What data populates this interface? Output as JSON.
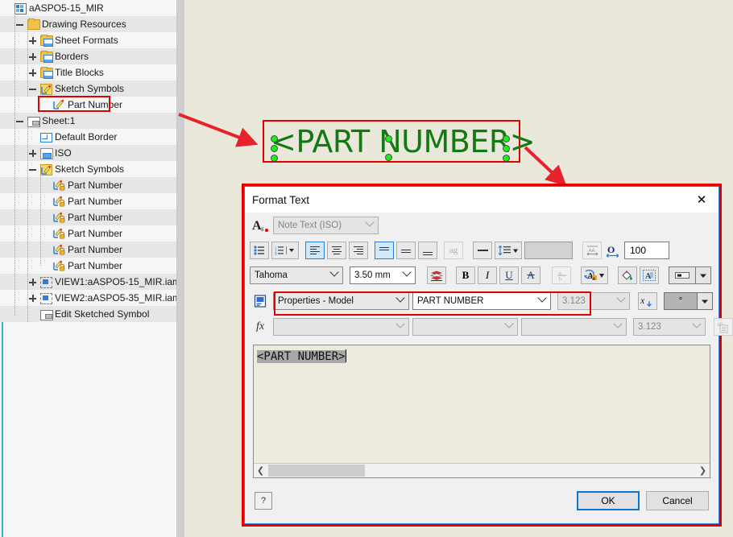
{
  "app": {
    "document_title": "aASPO5-15_MIR"
  },
  "tree": {
    "items": [
      {
        "label": "aASPO5-15_MIR",
        "icon": "assembly-icon",
        "depth": 0,
        "expander": "none",
        "alt": false
      },
      {
        "label": "Drawing Resources",
        "icon": "folder-icon",
        "depth": 1,
        "expander": "minus",
        "alt": true
      },
      {
        "label": "Sheet Formats",
        "icon": "folder-blue-icon",
        "depth": 2,
        "expander": "plus",
        "alt": false
      },
      {
        "label": "Borders",
        "icon": "folder-blue-icon",
        "depth": 2,
        "expander": "plus",
        "alt": true
      },
      {
        "label": "Title Blocks",
        "icon": "folder-blue-icon",
        "depth": 2,
        "expander": "plus",
        "alt": false
      },
      {
        "label": "Sketch Symbols",
        "icon": "sketch-symbol-icon",
        "depth": 2,
        "expander": "minus",
        "alt": true
      },
      {
        "label": "Part Number",
        "icon": "sketch-symbol-item-icon",
        "depth": 3,
        "expander": "none",
        "alt": false
      },
      {
        "label": "Sheet:1",
        "icon": "sheet-icon",
        "depth": 1,
        "expander": "minus",
        "alt": true
      },
      {
        "label": "Default Border",
        "icon": "border-icon",
        "depth": 2,
        "expander": "none",
        "alt": false
      },
      {
        "label": "ISO",
        "icon": "title-block-icon",
        "depth": 2,
        "expander": "plus",
        "alt": true
      },
      {
        "label": "Sketch Symbols",
        "icon": "sketch-symbol-icon",
        "depth": 2,
        "expander": "minus",
        "alt": false
      },
      {
        "label": "Part Number",
        "icon": "sketch-symbol-locked-icon",
        "depth": 3,
        "expander": "none",
        "alt": true
      },
      {
        "label": "Part Number",
        "icon": "sketch-symbol-locked-icon",
        "depth": 3,
        "expander": "none",
        "alt": false
      },
      {
        "label": "Part Number",
        "icon": "sketch-symbol-locked-icon",
        "depth": 3,
        "expander": "none",
        "alt": true
      },
      {
        "label": "Part Number",
        "icon": "sketch-symbol-locked-icon",
        "depth": 3,
        "expander": "none",
        "alt": false
      },
      {
        "label": "Part Number",
        "icon": "sketch-symbol-locked-icon",
        "depth": 3,
        "expander": "none",
        "alt": true
      },
      {
        "label": "Part Number",
        "icon": "sketch-symbol-locked-icon",
        "depth": 3,
        "expander": "none",
        "alt": false
      },
      {
        "label": "VIEW1:aASPO5-15_MIR.iam",
        "icon": "view-icon",
        "depth": 2,
        "expander": "plus",
        "alt": true
      },
      {
        "label": "VIEW2:aASPO5-35_MIR.iam",
        "icon": "view-icon",
        "depth": 2,
        "expander": "plus",
        "alt": false
      },
      {
        "label": "Edit Sketched Symbol",
        "icon": "edit-sketched-symbol-icon",
        "depth": 2,
        "expander": "none",
        "alt": true
      }
    ],
    "highlighted_item": "Part Number"
  },
  "canvas": {
    "symbol_text": "<PART NUMBER>",
    "symbol_color": "#127A12",
    "grip_color": "#15F215",
    "annotation_color": "#E00000"
  },
  "dialog": {
    "title": "Format Text",
    "close_label": "✕",
    "style_combo": {
      "value": "Note Text (ISO)",
      "disabled": true
    },
    "row1_buttons": [
      {
        "name": "bullet-list-button",
        "glyph": "bullets",
        "state": "normal"
      },
      {
        "name": "numbered-list-button",
        "glyph": "numbers",
        "state": "normal"
      },
      {
        "name": "align-left-button",
        "glyph": "align-left",
        "state": "active"
      },
      {
        "name": "align-center-button",
        "glyph": "align-center",
        "state": "normal"
      },
      {
        "name": "align-right-button",
        "glyph": "align-right",
        "state": "normal"
      },
      {
        "name": "align-top-button",
        "glyph": "valign-top",
        "state": "active"
      },
      {
        "name": "align-middle-button",
        "glyph": "valign-middle",
        "state": "normal"
      },
      {
        "name": "align-bottom-button",
        "glyph": "valign-bottom",
        "state": "normal"
      },
      {
        "name": "stacked-text-button",
        "glyph": "ag",
        "state": "disabled"
      },
      {
        "name": "line-spacing-button",
        "glyph": "dash",
        "state": "normal"
      },
      {
        "name": "line-spacing-dropdown",
        "glyph": "spacing",
        "state": "normal"
      },
      {
        "name": "line-spacing-value-field",
        "glyph": "blankfield",
        "state": "disabled"
      },
      {
        "name": "text-stretch-button",
        "glyph": "stretch",
        "state": "normal"
      },
      {
        "name": "text-width-button",
        "glyph": "width",
        "state": "normal"
      }
    ],
    "percent_value": "100",
    "font_combo": {
      "value": "Tahoma"
    },
    "size_combo": {
      "value": "3.50 mm"
    },
    "row2_buttons": [
      {
        "name": "layers-button",
        "glyph": "layers"
      },
      {
        "name": "bold-button",
        "glyph": "B"
      },
      {
        "name": "italic-button",
        "glyph": "I"
      },
      {
        "name": "underline-button",
        "glyph": "U"
      },
      {
        "name": "strikethrough-button",
        "glyph": "A"
      },
      {
        "name": "fraction-button",
        "glyph": "ab",
        "state": "disabled"
      },
      {
        "name": "rotate-text-button",
        "glyph": "rotate"
      },
      {
        "name": "text-color-button",
        "glyph": "fill"
      },
      {
        "name": "edit-field-button",
        "glyph": "editfield"
      },
      {
        "name": "insert-symbol-button",
        "glyph": "symbol"
      }
    ],
    "component_combo": {
      "value": "Properties - Model"
    },
    "property_combo": {
      "value": "PART NUMBER"
    },
    "precision_combo": {
      "value": "3.123",
      "disabled": true
    },
    "parameter_combo_1": {
      "value": "",
      "disabled": true
    },
    "parameter_combo_2": {
      "value": "",
      "disabled": true
    },
    "parameter_combo_3": {
      "value": "",
      "disabled": true
    },
    "precision_combo_2": {
      "value": "3.123",
      "disabled": true
    },
    "symbol_dropdown": {
      "value": "°"
    },
    "insert_property_button": "x-insert-icon",
    "insert_parameter_button": "d0-insert-icon",
    "fx_label": "fx",
    "editor": {
      "content": "<PART NUMBER>",
      "selected": true
    },
    "footer": {
      "help_label": "?",
      "ok_label": "OK",
      "cancel_label": "Cancel"
    }
  }
}
